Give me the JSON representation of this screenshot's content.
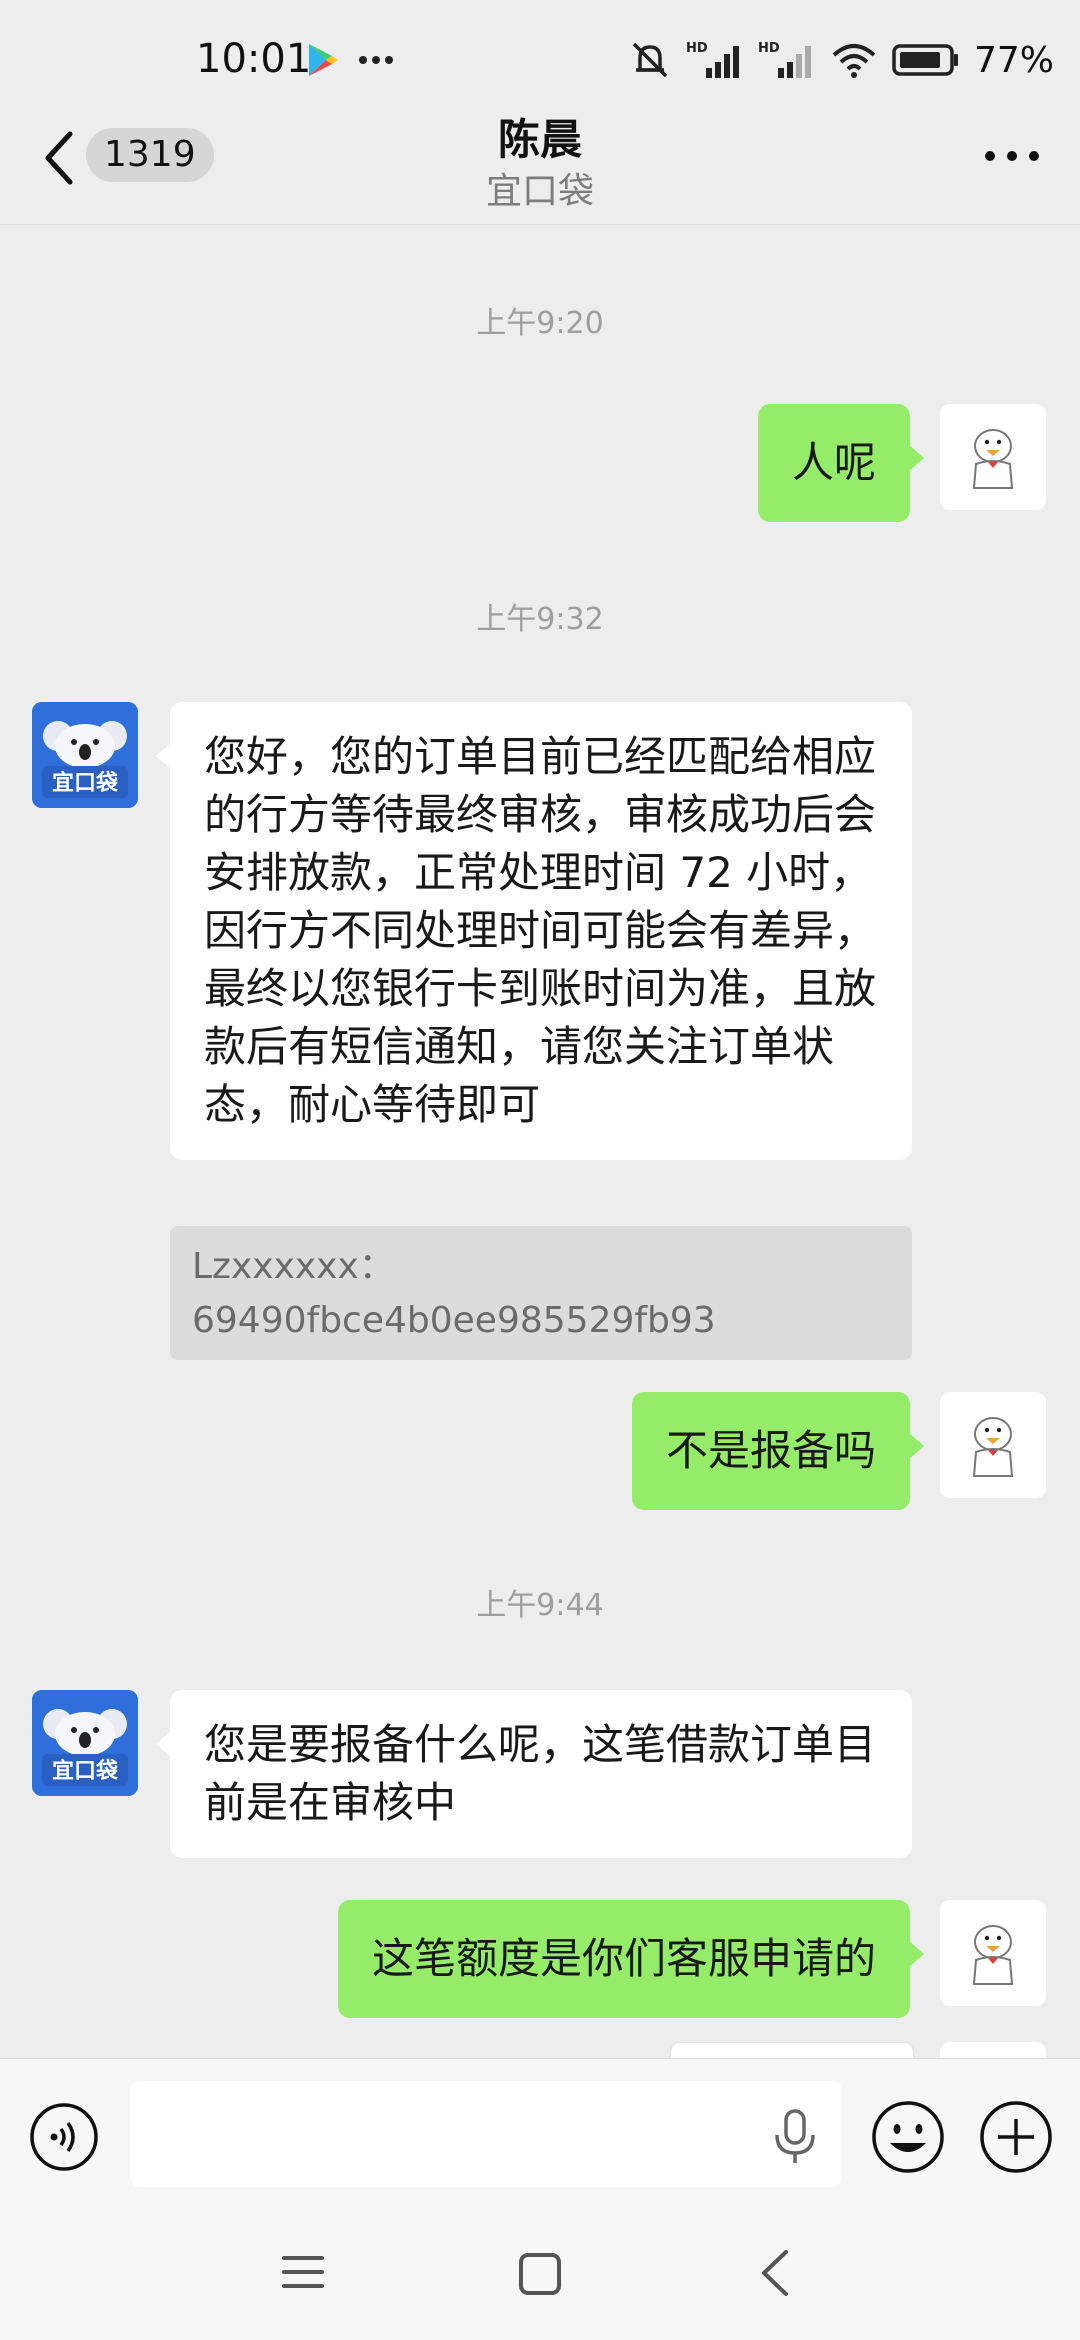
{
  "status_bar": {
    "time": "10:01",
    "battery": "77%",
    "network_labels": [
      "HD",
      "HD"
    ]
  },
  "header": {
    "back_icon": "chevron-left-icon",
    "unread_count": "1319",
    "title": "陈晨",
    "subtitle": "宜口袋",
    "more_icon": "more-dots-icon"
  },
  "messages": [
    {
      "type": "time",
      "text": "上午9:20"
    },
    {
      "type": "sent",
      "text": "人呢"
    },
    {
      "type": "time",
      "text": "上午9:32"
    },
    {
      "type": "received",
      "text": "您好，您的订单目前已经匹配给相应的行方等待最终审核，审核成功后会安排放款，正常处理时间 72 小时，因行方不同处理时间可能会有差异，最终以您银行卡到账时间为准，且放款后有短信通知，请您关注订单状态，耐心等待即可",
      "quote_line1": "Lzxxxxxx：",
      "quote_line2": "69490fbce4b0ee985529fb93"
    },
    {
      "type": "sent",
      "text": "不是报备吗"
    },
    {
      "type": "time",
      "text": "上午9:44"
    },
    {
      "type": "received",
      "text": "您是要报备什么呢，这笔借款订单目前是在审核中"
    },
    {
      "type": "sent",
      "text": "这笔额度是你们客服申请的"
    }
  ],
  "bot_avatar": {
    "brand_text": "宜口袋",
    "color": "#2f6fdc"
  },
  "input_bar": {
    "placeholder": ""
  },
  "colors": {
    "sent_bubble": "#95ec69",
    "received_bubble": "#ffffff",
    "background": "#ededed"
  }
}
